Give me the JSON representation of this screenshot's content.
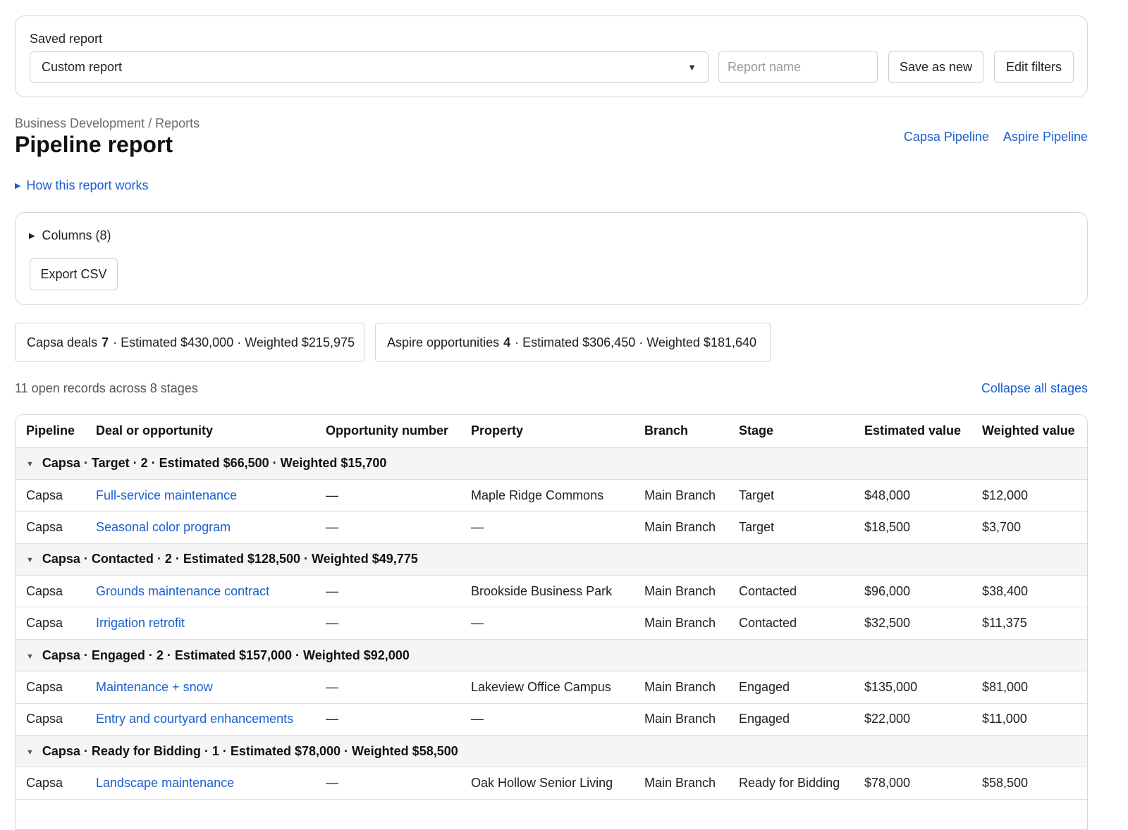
{
  "saved_report": {
    "label": "Saved report",
    "selected": "Custom report",
    "name_placeholder": "Report name",
    "save_as_new": "Save as new",
    "edit_filters": "Edit filters"
  },
  "header": {
    "breadcrumb": "Business Development / Reports",
    "title": "Pipeline report",
    "links": [
      "Capsa Pipeline",
      "Aspire Pipeline"
    ],
    "how_link": "How this report works"
  },
  "columns_panel": {
    "toggle": "Columns (8)",
    "export": "Export CSV"
  },
  "summary": {
    "capsa": {
      "prefix": "Capsa deals",
      "count": "7",
      "suffix": "· Estimated $430,000 · Weighted $215,975"
    },
    "aspire": {
      "prefix": "Aspire opportunities",
      "count": "4",
      "suffix": "· Estimated $306,450 · Weighted $181,640"
    }
  },
  "records_count": "11 open records across 8 stages",
  "collapse_all": "Collapse all stages",
  "table": {
    "headers": [
      "Pipeline",
      "Deal or opportunity",
      "Opportunity number",
      "Property",
      "Branch",
      "Stage",
      "Estimated value",
      "Weighted value"
    ],
    "groups": [
      {
        "label": "Capsa · Target · 2 · Estimated $66,500 · Weighted $15,700",
        "rows": [
          [
            "Capsa",
            "Full-service maintenance",
            "—",
            "Maple Ridge Commons",
            "Main Branch",
            "Target",
            "$48,000",
            "$12,000"
          ],
          [
            "Capsa",
            "Seasonal color program",
            "—",
            "—",
            "Main Branch",
            "Target",
            "$18,500",
            "$3,700"
          ]
        ]
      },
      {
        "label": "Capsa · Contacted · 2 · Estimated $128,500 · Weighted $49,775",
        "rows": [
          [
            "Capsa",
            "Grounds maintenance contract",
            "—",
            "Brookside Business Park",
            "Main Branch",
            "Contacted",
            "$96,000",
            "$38,400"
          ],
          [
            "Capsa",
            "Irrigation retrofit",
            "—",
            "—",
            "Main Branch",
            "Contacted",
            "$32,500",
            "$11,375"
          ]
        ]
      },
      {
        "label": "Capsa · Engaged · 2 · Estimated $157,000 · Weighted $92,000",
        "rows": [
          [
            "Capsa",
            "Maintenance + snow",
            "—",
            "Lakeview Office Campus",
            "Main Branch",
            "Engaged",
            "$135,000",
            "$81,000"
          ],
          [
            "Capsa",
            "Entry and courtyard enhancements",
            "—",
            "—",
            "Main Branch",
            "Engaged",
            "$22,000",
            "$11,000"
          ]
        ]
      },
      {
        "label": "Capsa · Ready for Bidding · 1 · Estimated $78,000 · Weighted $58,500",
        "rows": [
          [
            "Capsa",
            "Landscape maintenance",
            "—",
            "Oak Hollow Senior Living",
            "Main Branch",
            "Ready for Bidding",
            "$78,000",
            "$58,500"
          ]
        ]
      }
    ]
  },
  "colors": {
    "link": "#1b5fd1",
    "group_bg": "#f5f5f5",
    "border": "#d6d6d6"
  }
}
